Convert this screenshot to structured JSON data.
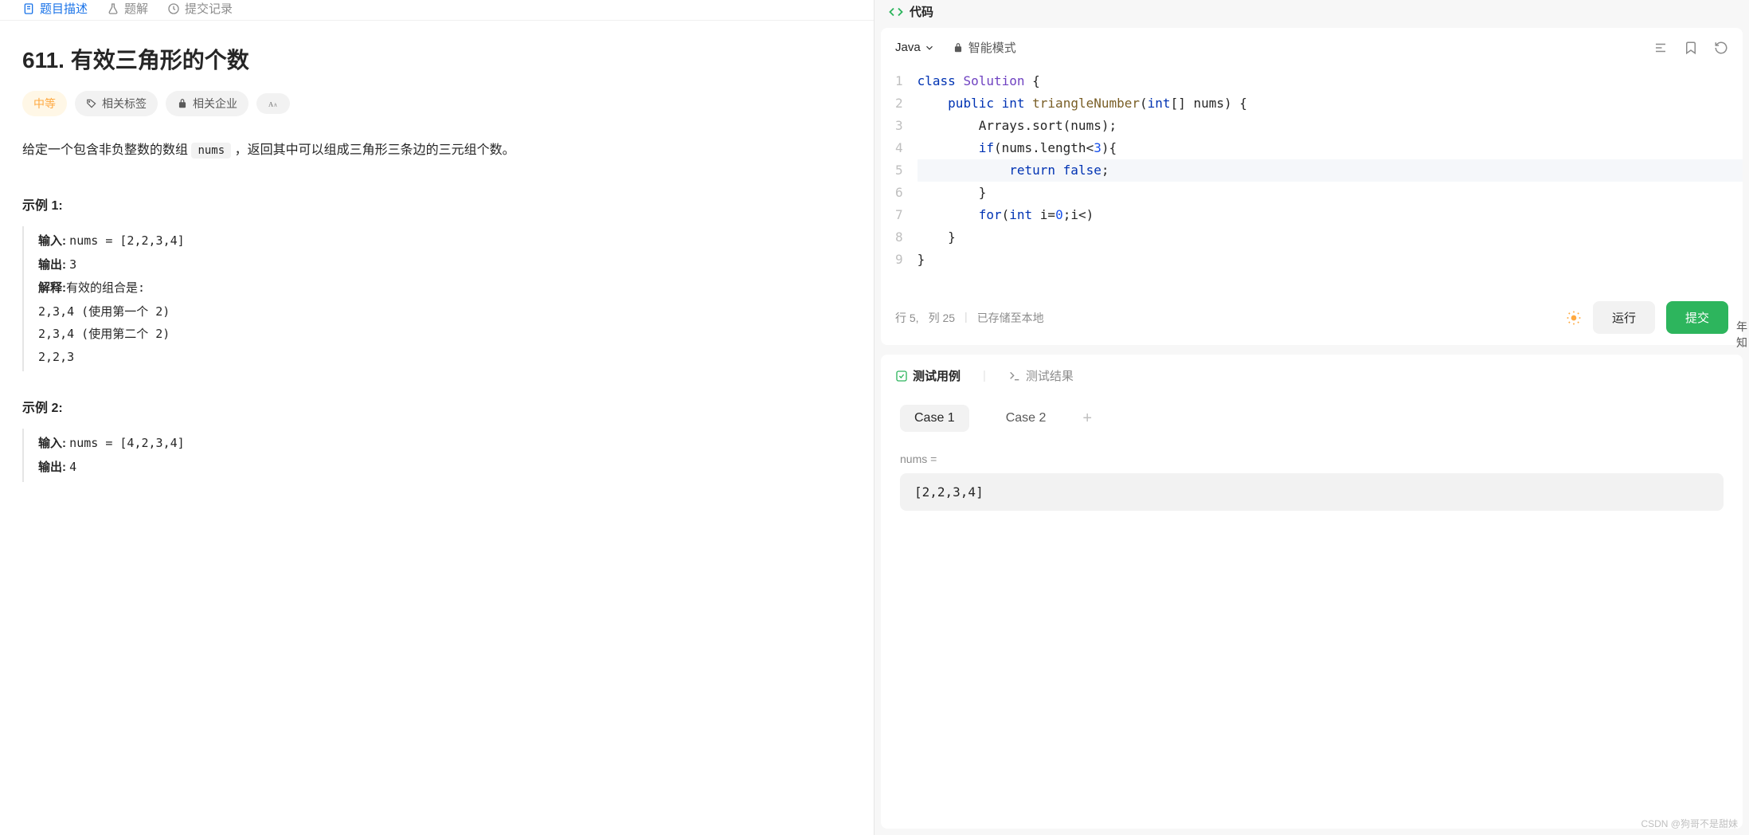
{
  "leftTabs": {
    "description": "题目描述",
    "solution": "题解",
    "submissions": "提交记录"
  },
  "problem": {
    "title": "611. 有效三角形的个数",
    "difficulty": "中等",
    "tagRelated": "相关标签",
    "tagCompany": "相关企业",
    "descriptionPrefix": "给定一个包含非负整数的数组 ",
    "descriptionCode": "nums",
    "descriptionSuffix": " ，返回其中可以组成三角形三条边的三元组个数。",
    "example1Title": "示例 1:",
    "example1InputLabel": "输入: ",
    "example1Input": "nums = [2,2,3,4]",
    "example1OutputLabel": "输出: ",
    "example1Output": "3",
    "example1ExplainLabel": "解释:",
    "example1ExplainText": "有效的组合是:",
    "example1Line1": "2,3,4 (使用第一个 2)",
    "example1Line2": "2,3,4 (使用第二个 2)",
    "example1Line3": "2,2,3",
    "example2Title": "示例 2:",
    "example2InputLabel": "输入: ",
    "example2Input": "nums = [4,2,3,4]",
    "example2OutputLabel": "输出: ",
    "example2Output": "4"
  },
  "editor": {
    "headerLabel": "代码",
    "language": "Java",
    "smartMode": "智能模式",
    "cursorLine": "行 5,",
    "cursorCol": "列 25",
    "savedLocal": "已存储至本地",
    "runLabel": "运行",
    "submitLabel": "提交"
  },
  "testPanel": {
    "casesTab": "测试用例",
    "resultsTab": "测试结果",
    "case1": "Case 1",
    "case2": "Case 2",
    "paramLabel": "nums =",
    "paramValue": "[2,2,3,4]"
  },
  "watermark": "CSDN @狗哥不是甜妹",
  "sideText1": "年",
  "sideText2": "知"
}
